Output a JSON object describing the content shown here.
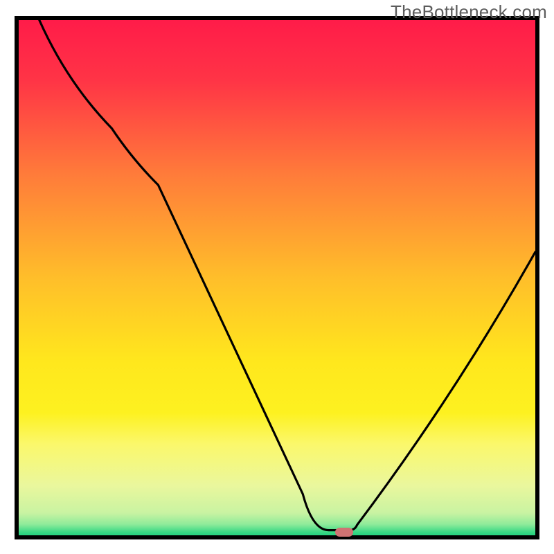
{
  "watermark": "TheBottleneck.com",
  "chart_data": {
    "type": "line",
    "title": "",
    "xlabel": "",
    "ylabel": "",
    "xlim": [
      0,
      100
    ],
    "ylim": [
      0,
      100
    ],
    "series": [
      {
        "name": "curve",
        "x": [
          4,
          18,
          27,
          55,
          60,
          64,
          65.5,
          100
        ],
        "y": [
          100,
          79,
          68,
          8,
          1,
          1,
          2,
          55
        ]
      }
    ],
    "marker": {
      "x": 63,
      "y": 0.6,
      "color": "#cf7373"
    },
    "gradient_stops": [
      {
        "offset": 0.0,
        "color": "#ff1b49"
      },
      {
        "offset": 0.12,
        "color": "#ff3446"
      },
      {
        "offset": 0.3,
        "color": "#ff7b3a"
      },
      {
        "offset": 0.5,
        "color": "#ffbe2a"
      },
      {
        "offset": 0.66,
        "color": "#ffe71d"
      },
      {
        "offset": 0.76,
        "color": "#fdf120"
      },
      {
        "offset": 0.82,
        "color": "#fbf86b"
      },
      {
        "offset": 0.9,
        "color": "#eaf79d"
      },
      {
        "offset": 0.953,
        "color": "#c9f3a2"
      },
      {
        "offset": 0.975,
        "color": "#8eeb9a"
      },
      {
        "offset": 0.99,
        "color": "#39d884"
      },
      {
        "offset": 1.0,
        "color": "#18cf7c"
      }
    ],
    "border_color": "#000000",
    "border_width": 6,
    "line_color": "#000000",
    "line_width": 3.2
  }
}
